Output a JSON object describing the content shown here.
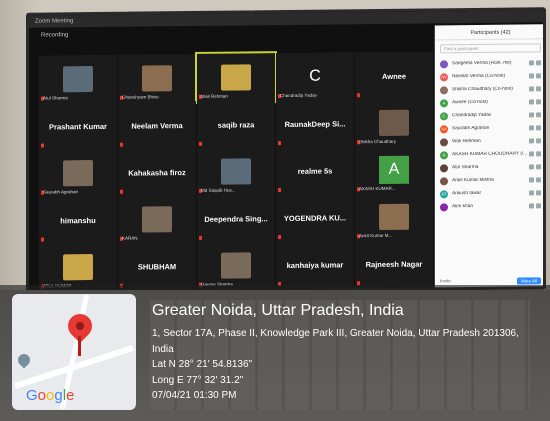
{
  "window": {
    "title": "Zoom Meeting",
    "recording": "Recording"
  },
  "tiles": [
    {
      "label": "",
      "caption": "Atul Sharma"
    },
    {
      "label": "",
      "caption": "Ghanshyam Bhive"
    },
    {
      "label": "",
      "caption": "Wali Rehman"
    },
    {
      "label": "C",
      "caption": "Chandradip Yadav"
    },
    {
      "label": "Awnee",
      "caption": ""
    },
    {
      "label": "Prashant Kumar",
      "caption": ""
    },
    {
      "label": "Neelam Verma",
      "caption": ""
    },
    {
      "label": "saqib raza",
      "caption": ""
    },
    {
      "label": "RaunakDeep Si...",
      "caption": ""
    },
    {
      "label": "",
      "caption": "Shikha Chaudhary"
    },
    {
      "label": "",
      "caption": "Saurabh Agrahari"
    },
    {
      "label": "Kahakasha firoz",
      "caption": ""
    },
    {
      "label": "",
      "caption": "Md Saquib Hus..."
    },
    {
      "label": "realme 5s",
      "caption": ""
    },
    {
      "label": "A",
      "caption": "AKASH KUMAR..."
    },
    {
      "label": "himanshu",
      "caption": ""
    },
    {
      "label": "",
      "caption": "KARAN"
    },
    {
      "label": "Deependra Sing...",
      "caption": ""
    },
    {
      "label": "YOGENDRA KU...",
      "caption": ""
    },
    {
      "label": "",
      "caption": "Ankit Kumar M..."
    },
    {
      "label": "",
      "caption": "ATUL KUMAR"
    },
    {
      "label": "SHUBHAM",
      "caption": ""
    },
    {
      "label": "",
      "caption": "Gaurav Sharma"
    },
    {
      "label": "kanhaiya kumar",
      "caption": ""
    },
    {
      "label": "Rajneesh Nagar",
      "caption": ""
    }
  ],
  "participants_panel": {
    "title": "Participants (42)",
    "search_placeholder": "Find a participant",
    "items": [
      {
        "initials": "",
        "name": "Sangeeta Verma (Host, me)",
        "color": "#7e57c2"
      },
      {
        "initials": "NV",
        "name": "Neelam Verma (Co-host)",
        "color": "#ef5350"
      },
      {
        "initials": "",
        "name": "Shikha Chaudhary (Co-host)",
        "color": "#8d6e63"
      },
      {
        "initials": "A",
        "name": "Awnee (Co-host)",
        "color": "#43a047"
      },
      {
        "initials": "C",
        "name": "Chandradip Yadav",
        "color": "#43a047"
      },
      {
        "initials": "SA",
        "name": "Saurabh Agrahari",
        "color": "#f4511e"
      },
      {
        "initials": "",
        "name": "Wali Rehman",
        "color": "#6d4c41"
      },
      {
        "initials": "A",
        "name": "AKASH KUMAR CHOUDHARY (I...",
        "color": "#43a047"
      },
      {
        "initials": "",
        "name": "Atul Sharma",
        "color": "#5d4037"
      },
      {
        "initials": "",
        "name": "Ankit Kumar Mishra",
        "color": "#795548"
      },
      {
        "initials": "AT",
        "name": "Ankush tawar",
        "color": "#26a69a"
      },
      {
        "initials": "",
        "name": "Alim khan",
        "color": "#8e24aa"
      }
    ],
    "footer": {
      "invite": "Invite",
      "mute_all": "Mute All"
    }
  },
  "geotag": {
    "city": "Greater Noida, Uttar Pradesh, India",
    "address_line1": "1, Sector 17A, Phase II, Knowledge Park III, Greater Noida, Uttar Pradesh 201306,",
    "address_line2": "India",
    "lat": "Lat N 28° 21' 54.8136\"",
    "long": "Long E 77° 32' 31.2\"",
    "datetime": "07/04/21 01:30 PM",
    "map_brand": "Google"
  }
}
